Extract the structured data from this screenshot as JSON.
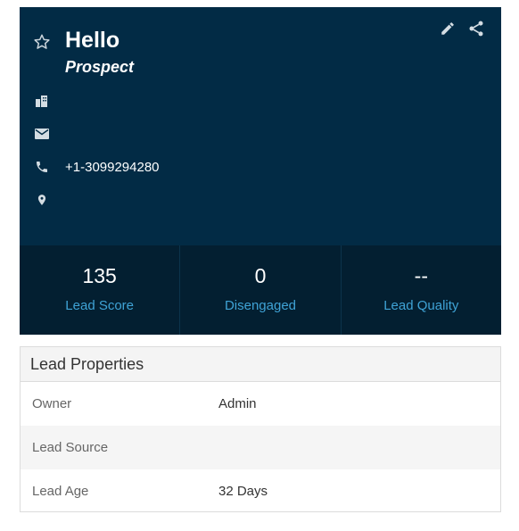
{
  "header": {
    "title": "Hello",
    "subtitle": "Prospect",
    "icons": [
      "star-outline-icon",
      "pencil-icon",
      "share-icon"
    ]
  },
  "contact": {
    "company": "",
    "email": "",
    "phone": "+1-3099294280",
    "location": "",
    "icons": [
      "building-icon",
      "envelope-icon",
      "phone-icon",
      "map-pin-icon"
    ]
  },
  "stats": [
    {
      "value": "135",
      "label": "Lead Score"
    },
    {
      "value": "0",
      "label": "Disengaged"
    },
    {
      "value": "--",
      "label": "Lead Quality"
    }
  ],
  "properties": {
    "title": "Lead Properties",
    "rows": [
      {
        "label": "Owner",
        "value": "Admin"
      },
      {
        "label": "Lead Source",
        "value": ""
      },
      {
        "label": "Lead Age",
        "value": "32 Days"
      }
    ]
  },
  "colors": {
    "card_bg": "#022b45",
    "stats_bg": "#031f31",
    "accent_link": "#3fa3d6",
    "text_light": "#ffffff"
  }
}
